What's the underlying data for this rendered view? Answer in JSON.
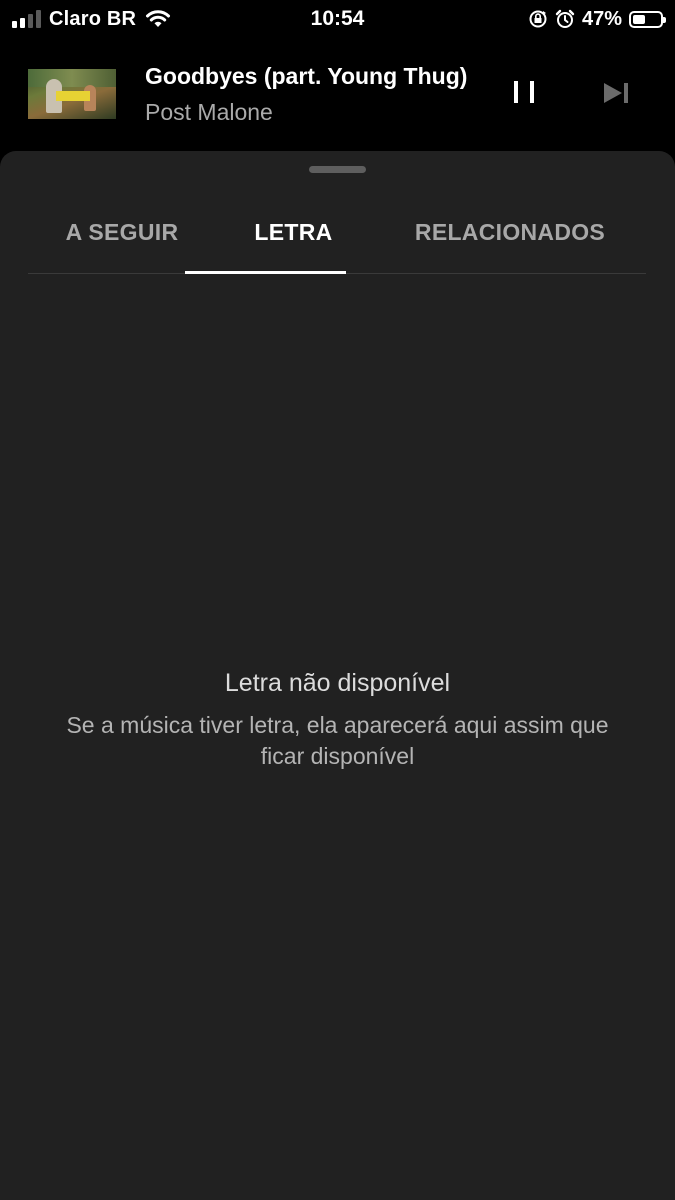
{
  "status_bar": {
    "carrier": "Claro BR",
    "time": "10:54",
    "battery_percent": "47%",
    "battery_level": 0.47,
    "signal_bars": 4,
    "signal_bars_filled": 2,
    "icons": [
      "signal-icon",
      "wifi-icon",
      "orientation-lock-icon",
      "alarm-icon",
      "battery-icon"
    ]
  },
  "player": {
    "title": "Goodbyes (part. Young Thug)",
    "artist": "Post Malone",
    "controls": {
      "pause_icon": "pause-icon",
      "next_icon": "skip-next-icon"
    }
  },
  "tabs": [
    {
      "label": "A SEGUIR",
      "active": false
    },
    {
      "label": "LETRA",
      "active": true
    },
    {
      "label": "RELACIONADOS",
      "active": false
    }
  ],
  "lyrics": {
    "empty_title": "Letra não disponível",
    "empty_description": "Se a música tiver letra, ela aparecerá aqui assim que ficar disponível"
  },
  "colors": {
    "background": "#000000",
    "sheet": "#212121",
    "active_tab": "#ffffff",
    "inactive_tab": "#a8a8a8"
  }
}
